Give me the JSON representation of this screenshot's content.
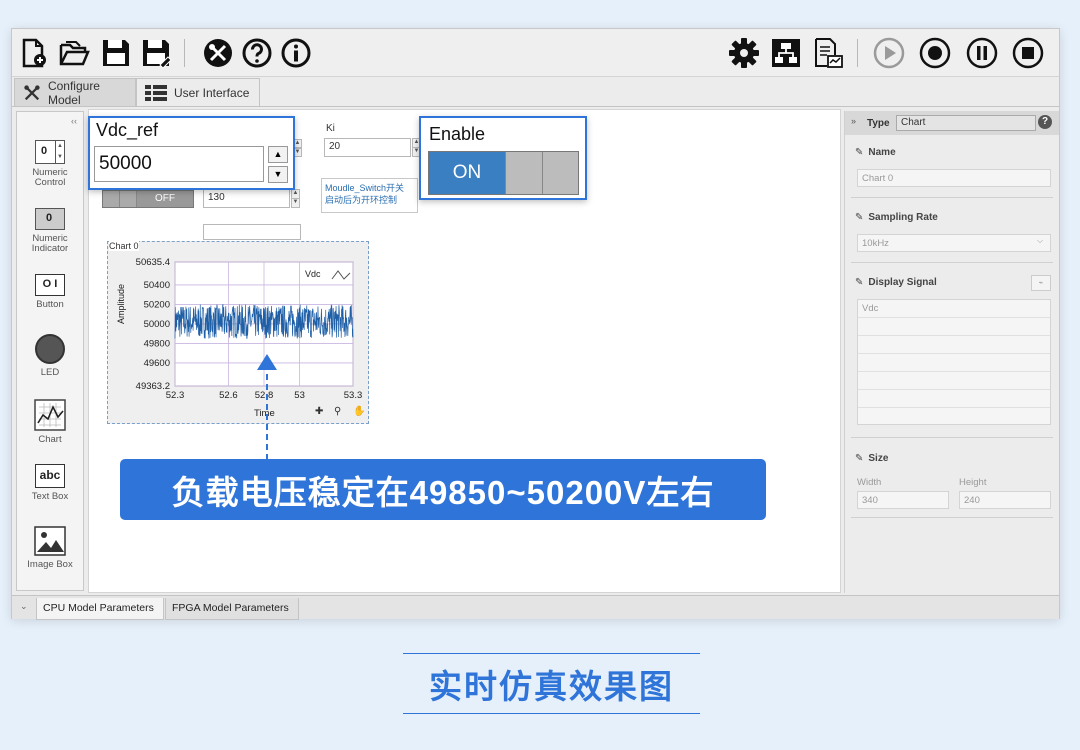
{
  "toolbar": {
    "left_icons": [
      "new-file-icon",
      "open-folder-icon",
      "save-icon",
      "save-as-icon",
      "tools-icon",
      "help-icon",
      "info-icon"
    ],
    "right_icons": [
      "gear-icon",
      "network-icon",
      "export-report-icon",
      "play-icon",
      "record-icon",
      "pause-icon",
      "stop-icon"
    ]
  },
  "tabs": [
    {
      "label": "Configure Model",
      "icon": "wrench-icon",
      "active": true
    },
    {
      "label": "User Interface",
      "icon": "list-icon",
      "active": false
    }
  ],
  "palette": [
    {
      "label": "Numeric Control",
      "glyph": "0"
    },
    {
      "label": "Numeric Indicator",
      "glyph": "0"
    },
    {
      "label": "Button",
      "glyph": "O I"
    },
    {
      "label": "LED",
      "glyph": ""
    },
    {
      "label": "Chart",
      "glyph": ""
    },
    {
      "label": "Text Box",
      "glyph": "abc"
    },
    {
      "label": "Image Box",
      "glyph": ""
    }
  ],
  "collapse_glyph": "‹‹",
  "canvas": {
    "ki_label": "Ki",
    "ki_value": "20",
    "value_130": "130",
    "off_label": "OFF",
    "switch_note": "Moudle_Switch开关\n启动后为开环控制"
  },
  "vdc_popup": {
    "title": "Vdc_ref",
    "value": "50000"
  },
  "enable_popup": {
    "title": "Enable",
    "on_label": "ON"
  },
  "chart": {
    "frame_label": "Chart 0",
    "legend": "Vdc"
  },
  "chart_data": {
    "type": "line",
    "title": "",
    "xlabel": "Time",
    "ylabel": "Amplitude",
    "xlim": [
      52.3,
      53.3
    ],
    "ylim": [
      49363.2,
      50635.4
    ],
    "x_ticks": [
      "52.3",
      "52.6",
      "52.8",
      "53",
      "53.3"
    ],
    "y_ticks": [
      "50635.4",
      "50400",
      "50200",
      "50000",
      "49800",
      "49600",
      "49363.2"
    ],
    "series": [
      {
        "name": "Vdc",
        "band_min": 49850,
        "band_max": 50200,
        "center": 50000,
        "color": "#1f5fa6"
      }
    ],
    "grid": true,
    "legend_position": "top-right"
  },
  "props": {
    "type_label": "Type",
    "type_value": "Chart",
    "name_label": "Name",
    "name_value": "Chart 0",
    "rate_label": "Sampling Rate",
    "rate_value": "10kHz",
    "signal_label": "Display Signal",
    "signal_value": "Vdc",
    "size_label": "Size",
    "width_label": "Width",
    "width_value": "340",
    "height_label": "Height",
    "height_value": "240"
  },
  "bottom_tabs": [
    {
      "label": "CPU Model Parameters",
      "active": true
    },
    {
      "label": "FPGA Model Parameters",
      "active": false
    }
  ],
  "annotation": "负载电压稳定在49850~50200V左右",
  "caption": "实时仿真效果图",
  "colors": {
    "accent": "#2f74d8",
    "switch_on": "#3a7fc1",
    "trace": "#1f5fa6"
  }
}
